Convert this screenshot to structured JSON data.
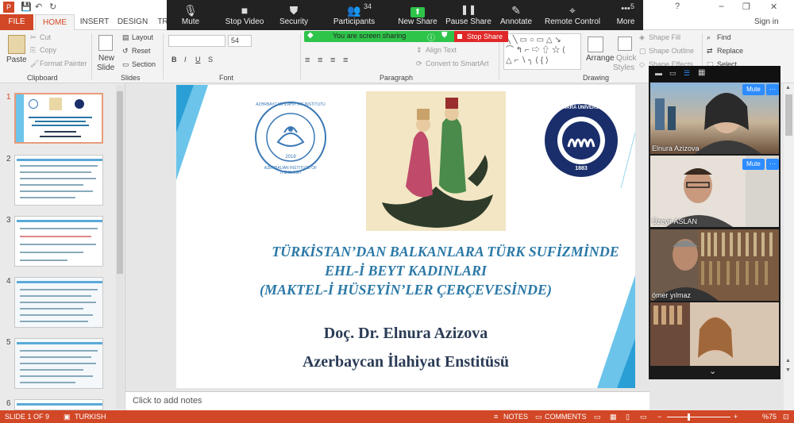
{
  "titlebar": {
    "signin": "Sign in",
    "minimize": "−",
    "restore": "❐",
    "close": "✕",
    "question": "?"
  },
  "tabs": [
    "FILE",
    "HOME",
    "INSERT",
    "DESIGN",
    "TR"
  ],
  "ribbon": {
    "paste": "Paste",
    "cut": "Cut",
    "copy": "Copy",
    "format_painter": "Format Painter",
    "clipboard": "Clipboard",
    "new_slide": "New",
    "new_slide2": "Slide",
    "layout": "Layout",
    "reset": "Reset",
    "section": "Section",
    "slides": "Slides",
    "font_size": "54",
    "font": "Font",
    "align_text": "Align Text",
    "convert_smartart": "Convert to SmartArt",
    "paragraph": "Paragraph",
    "arrange": "Arrange",
    "quick_styles": "Quick",
    "quick_styles2": "Styles",
    "shape_fill": "Shape Fill",
    "shape_outline": "Shape Outline",
    "shape_effects": "Shape Effects",
    "drawing": "Drawing",
    "find": "Find",
    "replace": "Replace",
    "select": "Select"
  },
  "zoom": {
    "buttons": [
      {
        "label": "Mute",
        "icon": "🎙"
      },
      {
        "label": "Stop Video",
        "icon": "■"
      },
      {
        "label": "Security",
        "icon": "⛊"
      },
      {
        "label": "Participants",
        "icon": "👥"
      },
      {
        "label": "New Share",
        "icon": "⬆"
      },
      {
        "label": "Pause Share",
        "icon": "❚❚"
      },
      {
        "label": "Annotate",
        "icon": "✎"
      },
      {
        "label": "Remote Control",
        "icon": "⌖"
      },
      {
        "label": "More",
        "icon": "•••"
      }
    ],
    "participants_count": "34",
    "more_count": "5",
    "sharing_text": "You are screen sharing",
    "stop_share": "Stop Share"
  },
  "thumbnails": [
    {
      "num": "1"
    },
    {
      "num": "2"
    },
    {
      "num": "3"
    },
    {
      "num": "4"
    },
    {
      "num": "5"
    },
    {
      "num": "6"
    }
  ],
  "slide": {
    "logo_left_top": "AZƏRBAYCAN İLAHİYYAT İNSTİTUTU",
    "logo_left_bottom": "AZERBAIJAN INSTITUTE OF THEOLOGY",
    "logo_left_year": "2018",
    "logo_right_top": "MARMARA ÜNİVERSİTESİ",
    "logo_right_year": "1883",
    "title1": "TÜRKİSTAN’DAN BALKANLARA TÜRK SUFİZMİNDE",
    "title2": "EHL-İ BEYT KADINLARI",
    "title3": "(MAKTEL-İ HÜSEYİN’LER ÇERÇEVESİNDE)",
    "author": "Doç. Dr. Elnura Azizova",
    "institute": "Azerbaycan İlahiyat Enstitüsü"
  },
  "notes_placeholder": "Click to add notes",
  "status": {
    "slide": "SLIDE 1 OF 9",
    "language": "TURKISH",
    "notes": "NOTES",
    "comments": "COMMENTS",
    "zoom": "%75"
  },
  "video": {
    "participants": [
      {
        "name": "Elnura Azizova",
        "mute": "Mute"
      },
      {
        "name": "Üzeyir ASLAN",
        "mute": "Mute"
      },
      {
        "name": "ömer yılmaz"
      },
      {
        "name": ""
      }
    ]
  },
  "colors": {
    "accent": "#d24726",
    "slide_title": "#2a78a6",
    "slide_author": "#2a3b55",
    "zoom_blue": "#2d8cff"
  }
}
